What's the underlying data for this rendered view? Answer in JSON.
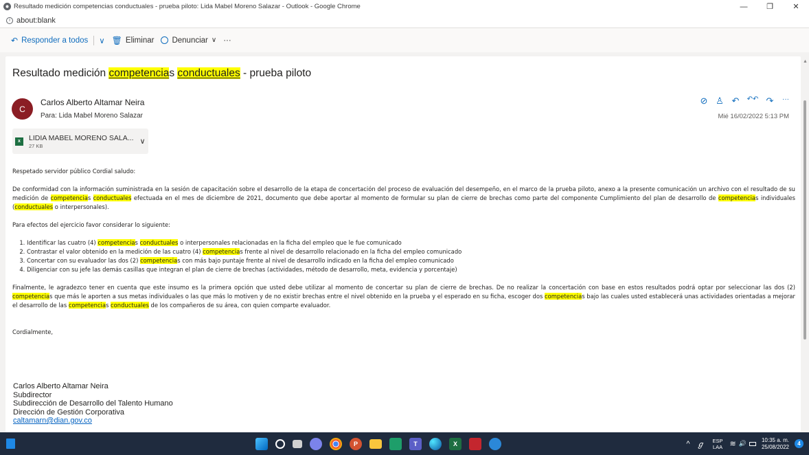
{
  "window": {
    "title": "Resultado medición competencias conductuales - prueba piloto: Lida Mabel Moreno Salazar - Outlook - Google Chrome",
    "minimize": "—",
    "maximize": "❐",
    "close": "✕"
  },
  "address": {
    "url": "about:blank",
    "info_glyph": "i"
  },
  "toolbar": {
    "reply_all_icon": "↶",
    "reply_all": "Responder a todos",
    "chevron": "∨",
    "delete_icon": "🗑",
    "delete": "Eliminar",
    "report_icon": "⃠",
    "report": "Denunciar",
    "report_chevron": "∨",
    "more": "···"
  },
  "message": {
    "subject_parts": [
      "Resultado medición ",
      "competencia",
      "s ",
      "conductuales",
      " - prueba piloto"
    ],
    "avatar_initial": "C",
    "sender": "Carlos Alberto Altamar Neira",
    "to": "Para:  Lida Mabel Moreno Salazar",
    "date": "Mié 16/02/2022 5:13 PM",
    "action_icons": [
      "⊘",
      "♙",
      "↶",
      "↶↶",
      "↷",
      "···"
    ],
    "attachment": {
      "name": "LIDIA MABEL MORENO SALA...",
      "size": "27 KB",
      "icon_letter": "x",
      "chevron": "∨"
    }
  },
  "body": {
    "greeting": "Respetado servidor público Cordial saludo:",
    "p1": [
      "De conformidad con la información suministrada en la sesión de capacitación sobre el desarrollo de la etapa de concertación del proceso de evaluación del desempeño, en el marco de la prueba piloto, anexo a la presente comunicación un archivo con el resultado de su medición de ",
      "competencia",
      "s ",
      "conductuales",
      " efectuada en el mes de diciembre de 2021, documento que debe aportar al momento de formular su plan de cierre de brechas como parte del componente Cumplimiento del plan de desarrollo de ",
      "competencia",
      "s individuales (",
      "conductuales",
      " o interpersonales)."
    ],
    "p2": "Para efectos del ejercicio favor considerar lo siguiente:",
    "list": [
      [
        "Identificar las cuatro (4) ",
        "competencia",
        "s ",
        "conductuales",
        " o interpersonales relacionadas en la ficha del empleo que le fue comunicado"
      ],
      [
        "Contrastar el valor obtenido en la medición de las cuatro (4) ",
        "competencia",
        "s frente al nivel de desarrollo relacionado en la ficha del empleo comunicado"
      ],
      [
        "Concertar con su evaluador las dos (2) ",
        "competencia",
        "s con más bajo puntaje frente al nivel de desarrollo indicado en la ficha del empleo comunicado"
      ],
      [
        "Diligenciar con su jefe las demás casillas que integran el plan de cierre de brechas (actividades, método de desarrollo, meta, evidencia y porcentaje)"
      ]
    ],
    "p3": [
      "Finalmente, le agradezco tener en cuenta que este insumo es la primera opción que usted debe utilizar al momento de concertar su plan de cierre de brechas. De no realizar la concertación con base en estos resultados podrá optar por seleccionar las dos (2) ",
      "competencia",
      "s que más le aporten a sus metas individuales o las que más lo motiven y de no existir brechas entre el nivel obtenido en la prueba y el esperado en su ficha, escoger dos ",
      "competencia",
      "s bajo las cuales usted establecerá unas actividades orientadas a mejorar el desarrollo de las ",
      "competencia",
      "s ",
      "conductuales",
      " de los compañeros de su área, con quien comparte evaluador."
    ],
    "closing": "Cordialmente,"
  },
  "signature": {
    "name": "Carlos Alberto Altamar Neira",
    "role": "Subdirector",
    "unit": "Subdirección de Desarrollo del Talento Humano",
    "division": "Dirección de Gestión Corporativa",
    "email": "caltamarn@dian.gov.co"
  },
  "taskbar": {
    "tray_up": "^",
    "lang_top": "ESP",
    "lang_bottom": "LAA",
    "wifi": "≋",
    "volume": "🔊",
    "time": "10:35 a. m.",
    "date": "25/08/2022",
    "notifications": "4"
  },
  "colors": {
    "accent": "#0f6cbd",
    "highlight": "#ffff00",
    "avatar": "#8b1d24",
    "taskbar": "#1f2b3e"
  }
}
